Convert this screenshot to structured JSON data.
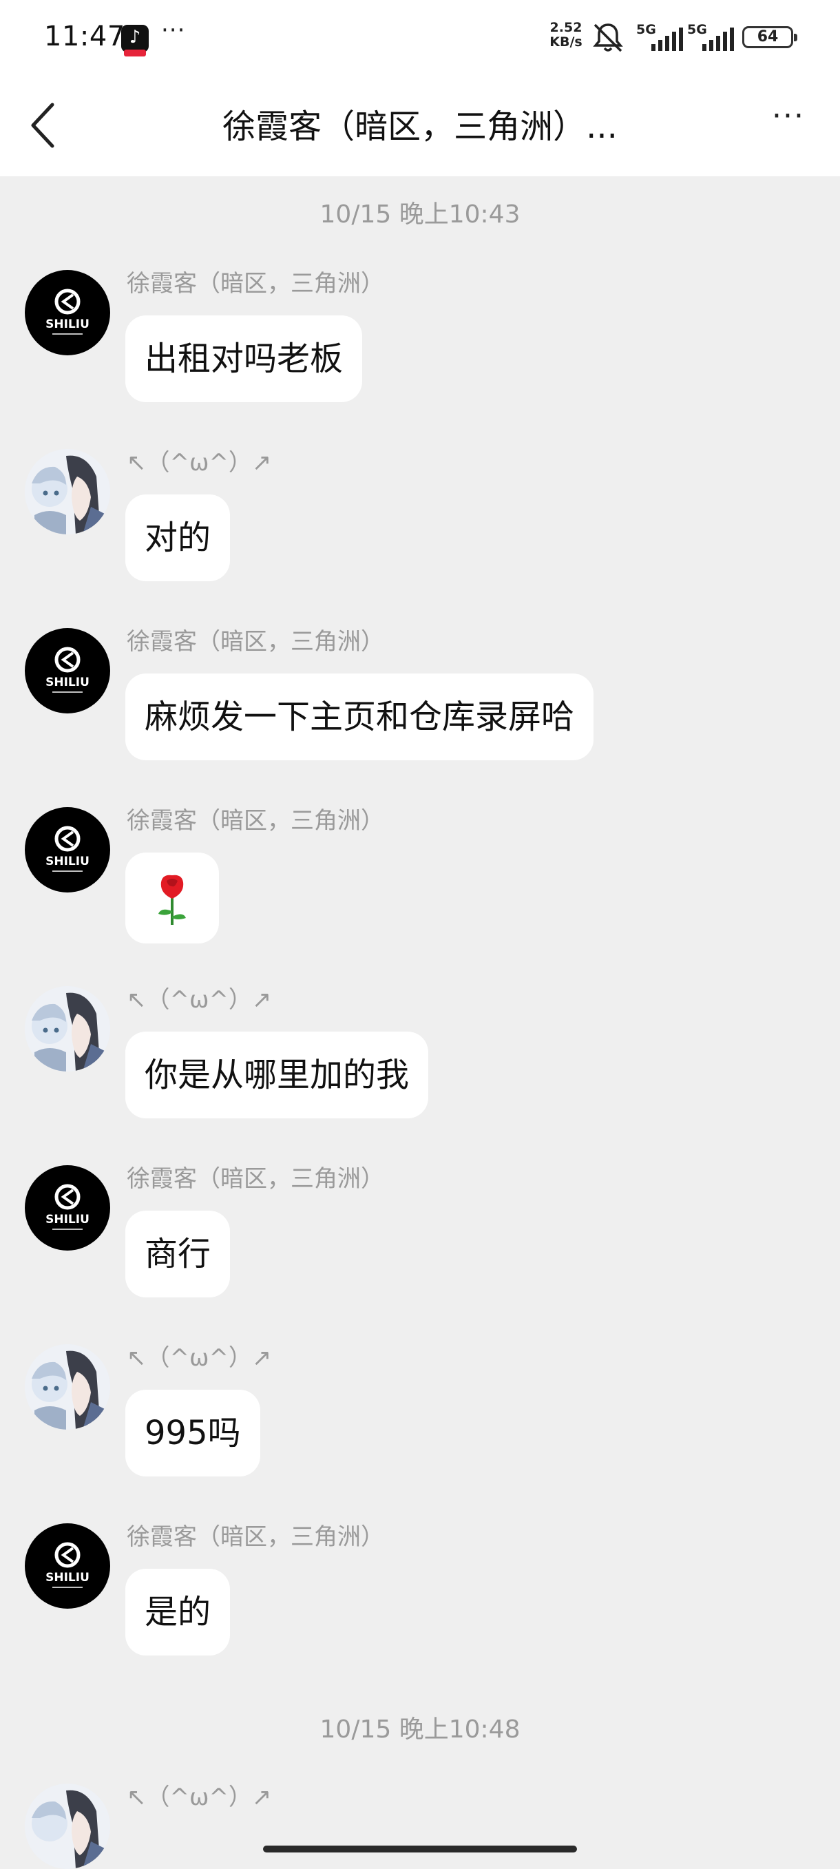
{
  "status_bar": {
    "time": "11:47",
    "app_icon": "tiktok-icon",
    "more": "···",
    "net_speed_value": "2.52",
    "net_speed_unit": "KB/s",
    "network_1": "5G",
    "network_2": "5G",
    "battery": "64"
  },
  "header": {
    "back_icon": "chevron-left-icon",
    "title": "徐霞客（暗区，三角洲）...",
    "more_icon": "more-horizontal-icon",
    "more_label": "···"
  },
  "timestamps": [
    "10/15 晚上10:43",
    "10/15 晚上10:48"
  ],
  "messages": [
    {
      "sender": "徐霞客（暗区，三角洲）",
      "avatar": "shiliu-logo",
      "text": "出租对吗老板"
    },
    {
      "sender": "↖（^ω^）↗",
      "avatar": "anime-avatar",
      "text": "对的"
    },
    {
      "sender": "徐霞客（暗区，三角洲）",
      "avatar": "shiliu-logo",
      "text": "麻烦发一下主页和仓库录屏哈"
    },
    {
      "sender": "徐霞客（暗区，三角洲）",
      "avatar": "shiliu-logo",
      "text": "🌹"
    },
    {
      "sender": "↖（^ω^）↗",
      "avatar": "anime-avatar",
      "text": "你是从哪里加的我"
    },
    {
      "sender": "徐霞客（暗区，三角洲）",
      "avatar": "shiliu-logo",
      "text": "商行"
    },
    {
      "sender": "↖（^ω^）↗",
      "avatar": "anime-avatar",
      "text": "995吗"
    },
    {
      "sender": "徐霞客（暗区，三角洲）",
      "avatar": "shiliu-logo",
      "text": "是的"
    },
    {
      "sender": "↖（^ω^）↗",
      "avatar": "anime-avatar",
      "text": ""
    }
  ],
  "brand_logo_text": "SHILIU",
  "colors": {
    "background": "#efefef",
    "bubble": "#ffffff",
    "secondary_text": "#9a9a9a",
    "tiktok_badge": "#e6243a"
  }
}
